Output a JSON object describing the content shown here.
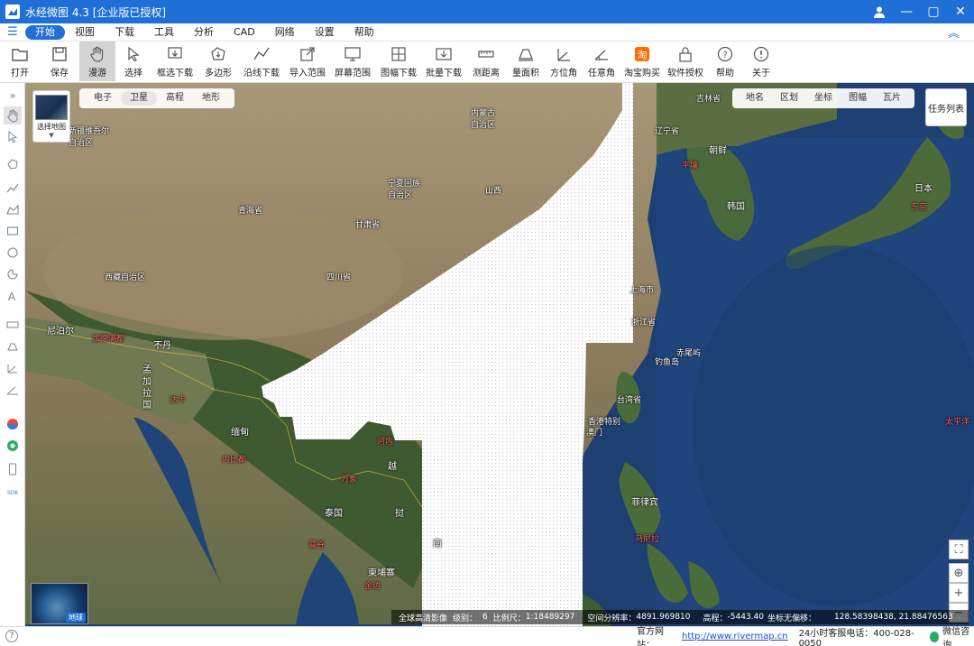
{
  "window": {
    "title": "水经微图 4.3 [企业版已授权]"
  },
  "menu": [
    "开始",
    "视图",
    "下载",
    "工具",
    "分析",
    "CAD",
    "网络",
    "设置",
    "帮助"
  ],
  "toolbar": [
    {
      "label": "打开",
      "icon": "folder-open-icon"
    },
    {
      "label": "保存",
      "icon": "save-icon"
    },
    {
      "label": "漫游",
      "icon": "hand-pan-icon"
    },
    {
      "label": "选择",
      "icon": "cursor-select-icon"
    },
    {
      "label": "框选下载",
      "icon": "box-download-icon"
    },
    {
      "label": "多边形",
      "icon": "polygon-download-icon"
    },
    {
      "label": "沿线下载",
      "icon": "line-download-icon"
    },
    {
      "label": "导入范围",
      "icon": "import-range-icon"
    },
    {
      "label": "屏幕范围",
      "icon": "screen-range-icon"
    },
    {
      "label": "图幅下载",
      "icon": "sheet-download-icon"
    },
    {
      "label": "批量下载",
      "icon": "batch-download-icon"
    },
    {
      "label": "测距离",
      "icon": "ruler-distance-icon"
    },
    {
      "label": "量面积",
      "icon": "area-measure-icon"
    },
    {
      "label": "方位角",
      "icon": "azimuth-icon"
    },
    {
      "label": "任意角",
      "icon": "angle-icon"
    },
    {
      "label": "淘宝购买",
      "icon": "taobao-icon"
    },
    {
      "label": "软件授权",
      "icon": "lock-license-icon"
    },
    {
      "label": "帮助",
      "icon": "help-icon"
    },
    {
      "label": "关于",
      "icon": "info-icon"
    }
  ],
  "map": {
    "layer_thumb_label": "选择地图",
    "basemap_options": [
      "电子",
      "卫星",
      "高程",
      "地形"
    ],
    "basemap_selected": "卫星",
    "overlay_options": [
      "地名",
      "区划",
      "坐标",
      "图幅",
      "瓦片"
    ],
    "task_list": "任务列表",
    "globe_label": "地球",
    "labels": {
      "xinjiang": "新疆维吾尔\n自治区",
      "inner_mongolia": "内蒙古\n自治区",
      "jilin": "吉林省",
      "liaoning": "辽宁省",
      "north_korea": "朝鲜",
      "pyongyang": "平壤",
      "south_korea": "韩国",
      "japan": "日本",
      "tokyo": "东京",
      "ningxia": "宁夏回族\n自治区",
      "qinghai": "青海省",
      "gansu": "甘肃省",
      "tibet": "西藏自治区",
      "sichuan": "四川省",
      "shanxi_partial": "山西",
      "shanghai": "上海市",
      "zhejiang": "浙江省",
      "chiwei": "赤尾屿",
      "diaoyu": "钓鱼岛",
      "taiwan": "台湾省",
      "hk": "香港特别",
      "macau": "澳门",
      "nepal": "尼泊尔",
      "kathmandu": "加德满都",
      "bhutan": "不丹",
      "bangladesh": "孟\n加\n拉\n国",
      "dhaka": "达卡",
      "myanmar": "缅甸",
      "naypyidaw": "内比都",
      "hanoi": "河内",
      "viet": "越",
      "laos": "挝",
      "vientiane": "万象",
      "thailand": "泰国",
      "bangkok": "曼谷",
      "cambodia": "柬埔寨",
      "phnom_penh": "金边",
      "nan": "南",
      "philippines": "菲律宾",
      "manila": "马尼拉",
      "pacific": "太平洋"
    },
    "status": {
      "source": "全球高清影像",
      "level_label": "级别：",
      "level": "6",
      "scale_label": "比例尺：",
      "scale": "1:18489297",
      "resolution_label": "空间分辨率：",
      "resolution": "4891.969810",
      "elevation_label": "高程：",
      "elevation": "-5443.40",
      "coord_label": "坐标无偏移：",
      "coord": "128.58398438, 21.88476563"
    }
  },
  "statusbar": {
    "site_label": "官方网站：",
    "site_url": "http://www.rivermap.cn",
    "hotline": "24小时客服电话：400-028-0050",
    "wechat": "微信咨询"
  }
}
